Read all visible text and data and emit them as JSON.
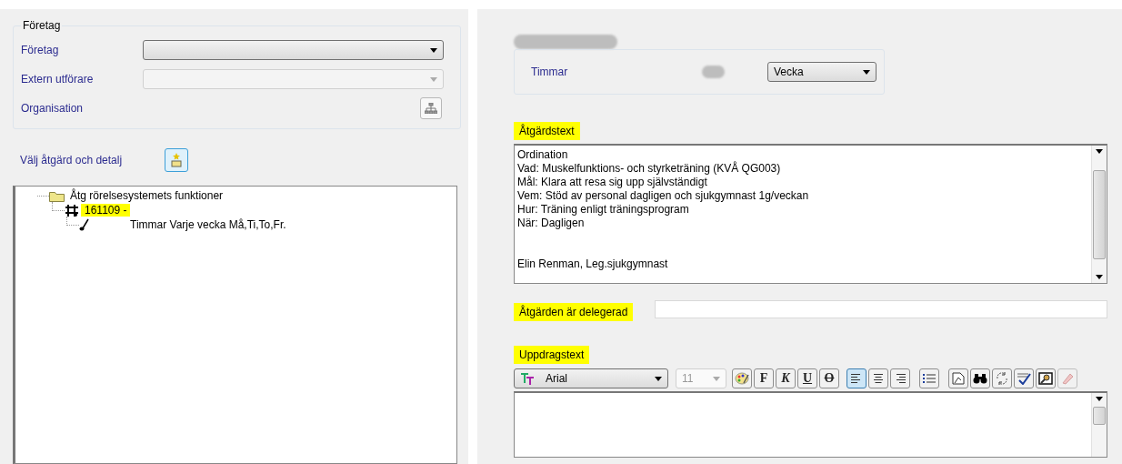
{
  "company_group": {
    "title": "Företag",
    "fields": [
      {
        "label": "Företag",
        "kind": "dropdown",
        "disabled": false
      },
      {
        "label": "Extern utförare",
        "kind": "dropdown",
        "disabled": true
      },
      {
        "label": "Organisation",
        "kind": "button"
      }
    ]
  },
  "choose": {
    "label": "Välj åtgärd och detalj"
  },
  "tree": [
    {
      "label": "Åtg rörelsesystemets funktioner",
      "kind": "folder",
      "highlighted": false,
      "children": [
        {
          "label": "161109 -",
          "kind": "measure",
          "highlighted": true,
          "children": [
            {
              "label": "Timmar  Varje vecka Må,Ti,To,Fr.",
              "kind": "detail",
              "highlighted": false
            }
          ]
        }
      ]
    }
  ],
  "hours_group": {
    "redacted_title": true,
    "label": "Timmar",
    "redacted_value": true,
    "unit": "Vecka"
  },
  "action_text": {
    "label": "Åtgärdstext",
    "highlighted": true,
    "lines": [
      "Ordination",
      "Vad: Muskelfunktions- och styrketräning (KVÅ QG003)",
      "Mål: Klara att resa sig upp självständigt",
      "Vem: Stöd av personal dagligen och sjukgymnast 1g/veckan",
      "Hur: Träning enligt träningsprogram",
      "När: Dagligen"
    ],
    "signature": "Elin Renman, Leg.sjukgymnast"
  },
  "delegated": {
    "label": "Åtgärden är delegerad",
    "highlighted": true
  },
  "assignment": {
    "label": "Uppdragstext",
    "highlighted": true,
    "font": "Arial",
    "size": "11",
    "size_disabled": true,
    "buttons": [
      {
        "kind": "color"
      },
      {
        "kind": "bold",
        "label": "F"
      },
      {
        "kind": "italic",
        "label": "K"
      },
      {
        "kind": "underline",
        "label": "U"
      },
      {
        "kind": "strike",
        "label": "O"
      },
      {
        "kind": "left",
        "selected": true
      },
      {
        "kind": "center",
        "selected": false
      },
      {
        "kind": "right",
        "selected": false
      },
      {
        "kind": "list"
      },
      {
        "kind": "page"
      },
      {
        "kind": "find"
      },
      {
        "kind": "replace"
      },
      {
        "kind": "spell"
      },
      {
        "kind": "zoom"
      },
      {
        "kind": "clear",
        "disabled": true
      }
    ]
  }
}
